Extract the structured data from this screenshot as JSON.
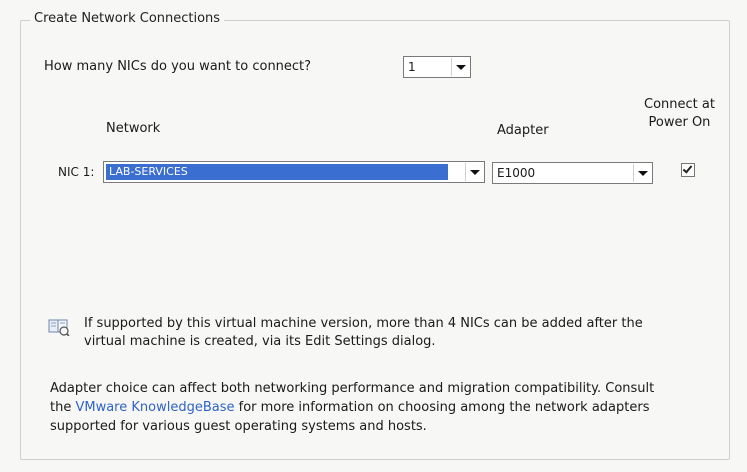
{
  "group": {
    "title": "Create Network Connections"
  },
  "nic_count": {
    "label": "How many NICs do you want to connect?",
    "value": "1"
  },
  "headers": {
    "network": "Network",
    "adapter": "Adapter",
    "connect_line1": "Connect at",
    "connect_line2": "Power On"
  },
  "nics": [
    {
      "label": "NIC 1:",
      "network": "LAB-SERVICES",
      "adapter": "E1000",
      "connect_at_power_on": true
    }
  ],
  "info": {
    "icon": "info-book-icon",
    "line1": "If supported by this virtual machine version, more than 4 NICs can be added after the",
    "line2": "virtual machine is created, via its Edit Settings dialog."
  },
  "adapter_note": {
    "line1": "Adapter choice can affect both networking performance and migration compatibility. Consult",
    "link_prefix": "the ",
    "link_text": "VMware KnowledgeBase",
    "line2_suffix": " for more information on choosing among the network adapters",
    "line3": "supported for various guest operating systems and hosts."
  },
  "colors": {
    "selection": "#3a6fd1",
    "link": "#2f63c8",
    "background": "#f7f7f5"
  }
}
